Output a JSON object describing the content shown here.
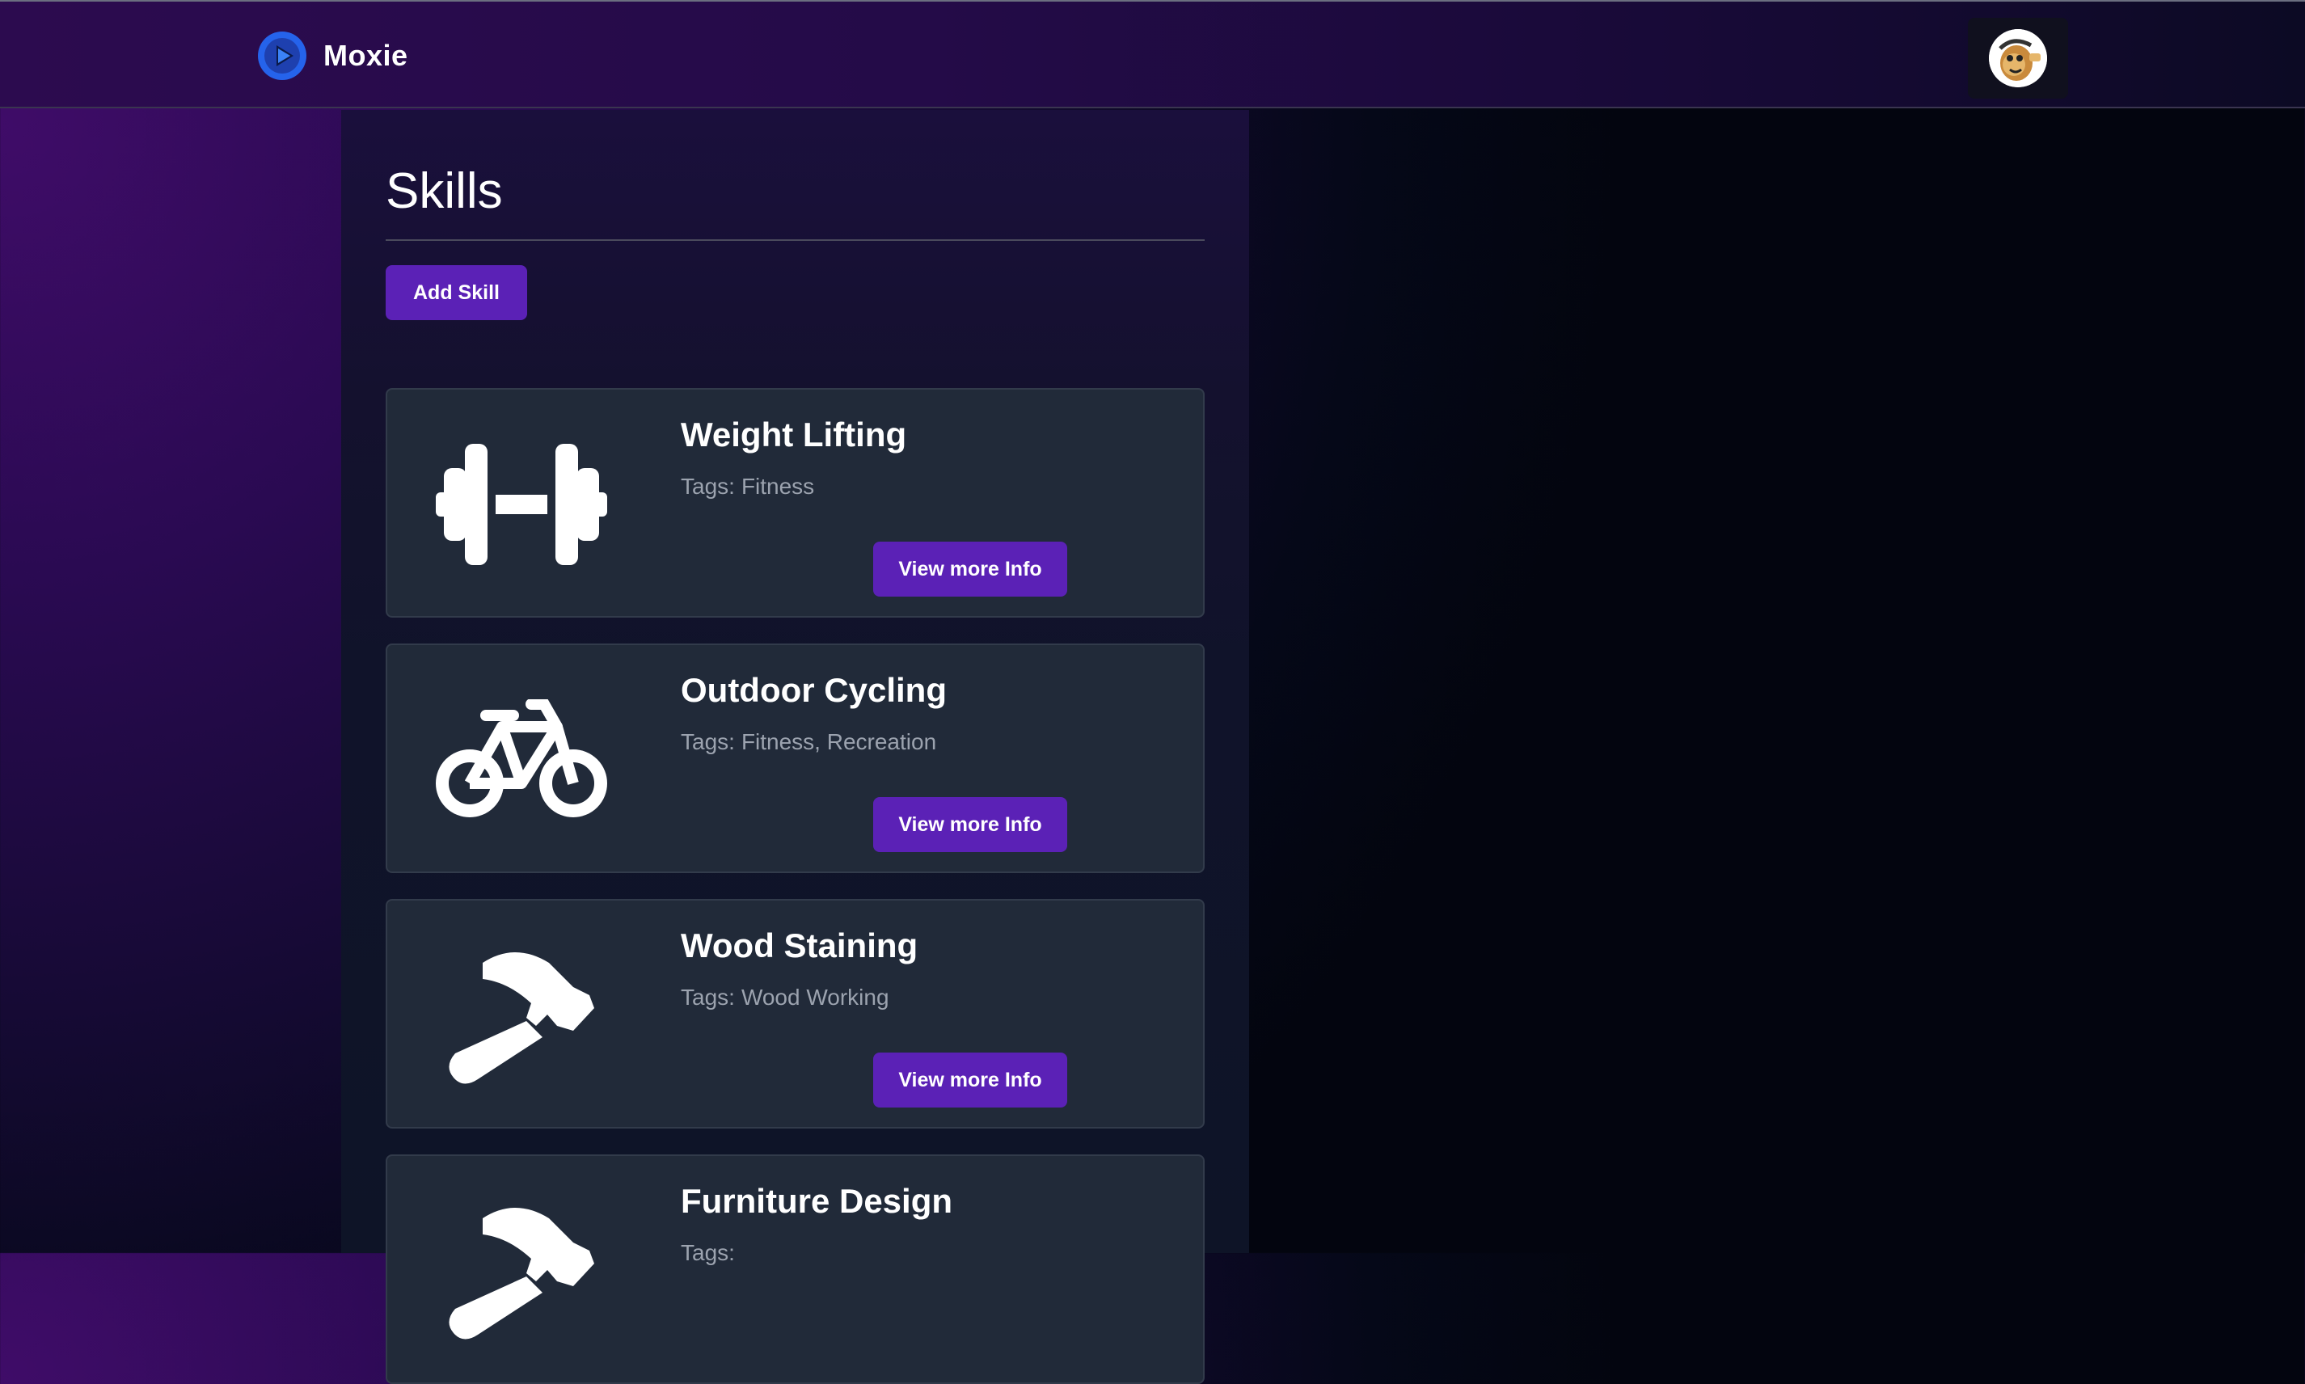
{
  "header": {
    "brand_name": "Moxie",
    "brand_logo_icon": "play-circle-icon",
    "avatar_icon": "user-avatar-cartoon"
  },
  "main": {
    "title": "Skills",
    "add_button_label": "Add Skill",
    "tags_prefix": "Tags:",
    "skills": [
      {
        "name": "Weight Lifting",
        "tags": "Fitness",
        "icon": "dumbbell-icon",
        "button_label": "View more Info"
      },
      {
        "name": "Outdoor Cycling",
        "tags": "Fitness, Recreation",
        "icon": "bicycle-icon",
        "button_label": "View more Info"
      },
      {
        "name": "Wood Staining",
        "tags": "Wood Working",
        "icon": "hammer-icon",
        "button_label": "View more Info"
      },
      {
        "name": "Furniture Design",
        "tags": "",
        "icon": "hammer-icon",
        "button_label": ""
      }
    ]
  },
  "colors": {
    "accent": "#5b21b6",
    "card_bg": "#212a39",
    "tag_text": "#9ca3af",
    "brand_logo": "#2563eb"
  }
}
